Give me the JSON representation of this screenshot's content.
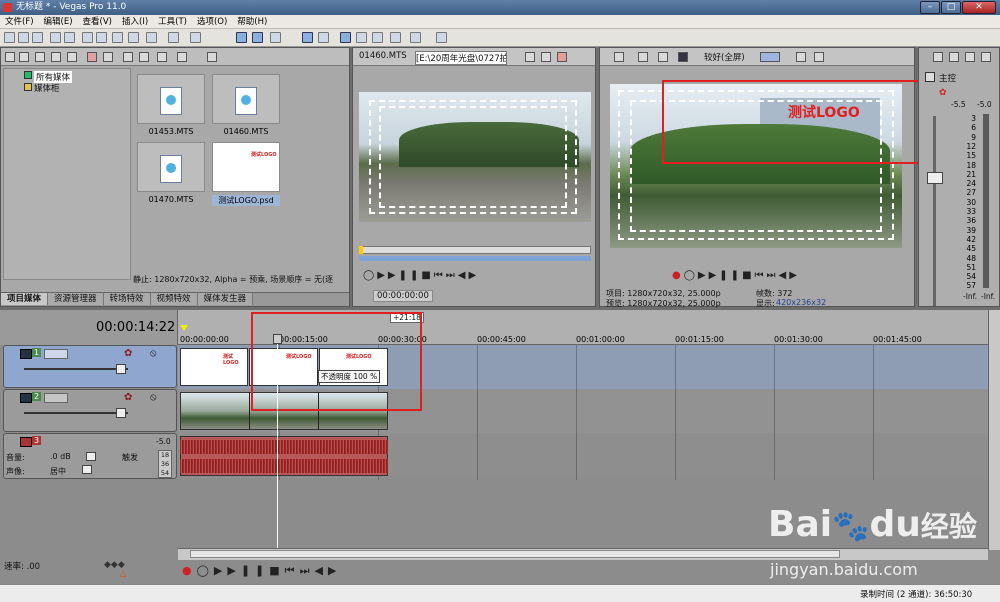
{
  "window": {
    "title": "无标题 * - Vegas Pro 11.0",
    "min": "–",
    "max": "□",
    "close": "✕"
  },
  "menu": [
    "文件(F)",
    "编辑(E)",
    "查看(V)",
    "插入(I)",
    "工具(T)",
    "选项(O)",
    "帮助(H)"
  ],
  "explorer": {
    "tree": [
      "所有媒体",
      "媒体柜"
    ],
    "files": [
      {
        "name": "01453.MTS"
      },
      {
        "name": "01460.MTS"
      },
      {
        "name": "01470.MTS"
      },
      {
        "name": "测试LOGO.psd",
        "thumb_text": "测试LOGO"
      }
    ],
    "status": "静止: 1280x720x32, Alpha = 预乘, 场景顺序 = 无(逐",
    "tabs": [
      "项目媒体",
      "资源管理器",
      "转场特效",
      "视频特效",
      "媒体发生器"
    ]
  },
  "trimmer": {
    "file": "01460.MTS",
    "path": "[E:\\20周年光盘\\0727拍",
    "timecode": "00:00:00:00"
  },
  "preview": {
    "quality": "较好(全屏)",
    "logo_text": "测试LOGO",
    "project": "项目: 1280x720x32, 25.000p",
    "preview": "预览: 1280x720x32, 25.000p",
    "frame": "帧数: 372",
    "display_label": "显示:",
    "display": "420x236x32"
  },
  "master": {
    "label": "主控",
    "top_left": "-5.5",
    "top_right": "-5.0",
    "scale": [
      "3",
      "6",
      "9",
      "12",
      "15",
      "18",
      "21",
      "24",
      "27",
      "30",
      "33",
      "36",
      "39",
      "42",
      "45",
      "48",
      "51",
      "54",
      "57"
    ],
    "bottom_left": "-Inf.",
    "bottom_right": "-Inf."
  },
  "timeline": {
    "timecode": "00:00:14:22",
    "cursor_badge": "+21:18",
    "ruler": [
      "00:00:00:00",
      "00:00:15:00",
      "00:00:30:00",
      "00:00:45:00",
      "00:01:00:00",
      "00:01:15:00",
      "00:01:30:00",
      "00:01:45:00"
    ],
    "tracks": [
      {
        "num": "1",
        "type": "video"
      },
      {
        "num": "2",
        "type": "video"
      },
      {
        "num": "3",
        "type": "audio",
        "volume_label": "音量:",
        "volume": ".0 dB",
        "trigger": "触发",
        "pan_label": "声像:",
        "pan": "居中",
        "meter_top": "-5.0",
        "meter": [
          "18",
          "36",
          "54"
        ]
      }
    ],
    "logo_thumb": "测试LOGO",
    "opacity_tip": "不透明度  100 %",
    "rate_label": "速率: .00"
  },
  "status": {
    "record": "录制时间 (2 通道): 36:50:30"
  },
  "watermark": {
    "brand": "Bai",
    "paw": "经验",
    "brand2": "du",
    "url": "jingyan.baidu.com"
  },
  "colors": {
    "accent_red": "#e02020",
    "selected_track": "#8fa7cf",
    "timeline_bg": "#8c8c8c"
  }
}
